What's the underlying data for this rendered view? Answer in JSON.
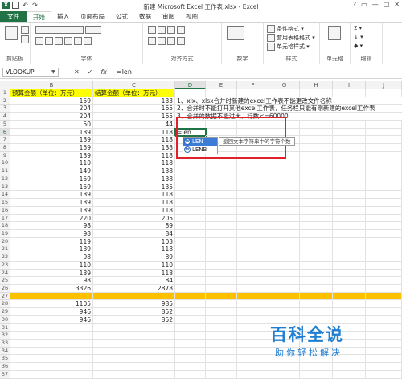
{
  "title_bar": {
    "title": "新建 Microsoft Excel 工作表.xlsx - Excel",
    "logo": "X",
    "controls": [
      "?",
      "▭",
      "—",
      "□",
      "✕"
    ]
  },
  "tabs": [
    "文件",
    "开始",
    "插入",
    "页面布局",
    "公式",
    "数据",
    "审阅",
    "视图"
  ],
  "ribbon": {
    "clipboard": {
      "label": "剪贴板"
    },
    "font": {
      "label": "字体"
    },
    "alignment": {
      "label": "对齐方式"
    },
    "number": {
      "label": "数字"
    },
    "styles": {
      "label": "样式",
      "items": [
        "条件格式 ▾",
        "套用表格格式 ▾",
        "单元格样式 ▾"
      ]
    },
    "cells": {
      "label": "单元格"
    },
    "editing": {
      "label": "编辑",
      "items": [
        "Σ ▾",
        "↓ ▾",
        "◆ ▾"
      ]
    }
  },
  "formula_bar": {
    "name_box": "VLOOKUP",
    "buttons": [
      "✕",
      "✓",
      "fx"
    ],
    "value": "=len"
  },
  "columns": [
    "A",
    "B",
    "C",
    "D",
    "E",
    "F",
    "G",
    "H",
    "I",
    "J"
  ],
  "sheet": {
    "header_b": "预算金额（单位：万元）",
    "header_c": "结算金额（单位：万元）",
    "notes": [
      "1、xlx、xlsx合并时新建的excel工作表不能更改文件名称",
      "2、合并时不能打开其他excel工作表，任务栏只能有刚新建的excel工作表",
      "3、合并的数据不能过大，行数<=60000"
    ],
    "active_cell_text": "=len",
    "rows": [
      {
        "n": "1",
        "b": "",
        "c": ""
      },
      {
        "n": "2",
        "b": "159",
        "c": "133"
      },
      {
        "n": "3",
        "b": "204",
        "c": "165"
      },
      {
        "n": "4",
        "b": "204",
        "c": "165"
      },
      {
        "n": "5",
        "b": "50",
        "c": "44"
      },
      {
        "n": "6",
        "b": "139",
        "c": "118"
      },
      {
        "n": "7",
        "b": "139",
        "c": "118"
      },
      {
        "n": "8",
        "b": "159",
        "c": "138"
      },
      {
        "n": "9",
        "b": "139",
        "c": "118"
      },
      {
        "n": "10",
        "b": "110",
        "c": "118"
      },
      {
        "n": "11",
        "b": "149",
        "c": "138"
      },
      {
        "n": "12",
        "b": "159",
        "c": "138"
      },
      {
        "n": "13",
        "b": "159",
        "c": "135"
      },
      {
        "n": "14",
        "b": "139",
        "c": "118"
      },
      {
        "n": "15",
        "b": "139",
        "c": "118"
      },
      {
        "n": "16",
        "b": "139",
        "c": "118"
      },
      {
        "n": "17",
        "b": "220",
        "c": "205"
      },
      {
        "n": "18",
        "b": "98",
        "c": "89"
      },
      {
        "n": "19",
        "b": "98",
        "c": "84"
      },
      {
        "n": "20",
        "b": "119",
        "c": "103"
      },
      {
        "n": "21",
        "b": "139",
        "c": "118"
      },
      {
        "n": "22",
        "b": "98",
        "c": "89"
      },
      {
        "n": "23",
        "b": "110",
        "c": "110"
      },
      {
        "n": "24",
        "b": "139",
        "c": "118"
      },
      {
        "n": "25",
        "b": "98",
        "c": "84"
      },
      {
        "n": "26",
        "b": "3326",
        "c": "2878"
      },
      {
        "n": "27",
        "b": "",
        "c": ""
      },
      {
        "n": "28",
        "b": "1105",
        "c": "985"
      },
      {
        "n": "29",
        "b": "946",
        "c": "852"
      },
      {
        "n": "30",
        "b": "946",
        "c": "852"
      },
      {
        "n": "31",
        "b": "",
        "c": ""
      },
      {
        "n": "32",
        "b": "",
        "c": ""
      },
      {
        "n": "33",
        "b": "",
        "c": ""
      },
      {
        "n": "34",
        "b": "",
        "c": ""
      },
      {
        "n": "35",
        "b": "",
        "c": ""
      },
      {
        "n": "36",
        "b": "",
        "c": ""
      },
      {
        "n": "37",
        "b": "",
        "c": ""
      }
    ]
  },
  "autocomplete": {
    "items": [
      "LEN",
      "LENB"
    ],
    "tooltip": "返回文本字符串中的字符个数"
  },
  "watermark": {
    "title": "百科全说",
    "subtitle": "助你轻松解决"
  },
  "colors": {
    "accent": "#217346",
    "header_fill": "#ffff00",
    "total_gap_fill": "#ffc000",
    "callout": "#e0202a"
  }
}
